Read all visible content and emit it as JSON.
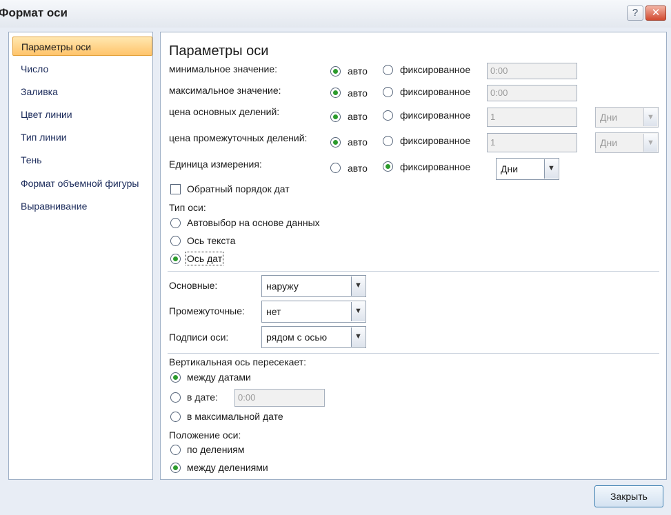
{
  "window": {
    "title": "Формат оси",
    "help_glyph": "?",
    "close_glyph": "✕"
  },
  "nav": {
    "items": [
      "Параметры оси",
      "Число",
      "Заливка",
      "Цвет линии",
      "Тип линии",
      "Тень",
      "Формат объемной фигуры",
      "Выравнивание"
    ],
    "selected_index": 0
  },
  "panel": {
    "heading": "Параметры оси",
    "rows": [
      {
        "label": "минимальное значение:",
        "auto": "авто",
        "fixed": "фиксированное",
        "value": "0:00"
      },
      {
        "label": "максимальное значение:",
        "auto": "авто",
        "fixed": "фиксированное",
        "value": "0:00"
      },
      {
        "label": "цена основных делений:",
        "auto": "авто",
        "fixed": "фиксированное",
        "value": "1",
        "unit": "Дни"
      },
      {
        "label": "цена промежуточных делений:",
        "auto": "авто",
        "fixed": "фиксированное",
        "value": "1",
        "unit": "Дни"
      },
      {
        "label": "Единица измерения:",
        "auto": "авто",
        "fixed": "фиксированное",
        "unit": "Дни"
      }
    ],
    "reverse_dates": {
      "label": "Обратный порядок дат",
      "checked": false
    },
    "axis_type": {
      "label": "Тип оси:",
      "options": [
        "Автовыбор на основе данных",
        "Ось текста",
        "Ось дат"
      ],
      "selected_index": 2
    },
    "tick_marks": {
      "major_label": "Основные:",
      "major_value": "наружу",
      "minor_label": "Промежуточные:",
      "minor_value": "нет",
      "labels_label": "Подписи оси:",
      "labels_value": "рядом с осью"
    },
    "vertical_crosses": {
      "label": "Вертикальная ось пересекает:",
      "between_dates": "между датами",
      "at_date": "в дате:",
      "at_date_value": "0:00",
      "at_max_date": "в максимальной дате",
      "selected": "between_dates"
    },
    "axis_position": {
      "label": "Положение оси:",
      "on_tick_marks": "по делениям",
      "between_tick_marks": "между делениями",
      "selected": "between_tick_marks"
    }
  },
  "footer": {
    "close_label": "Закрыть"
  },
  "colors": {
    "accent_selected": "#ffc46b",
    "radio_dot": "#2c9b2c",
    "border": "#9fb0c6"
  }
}
